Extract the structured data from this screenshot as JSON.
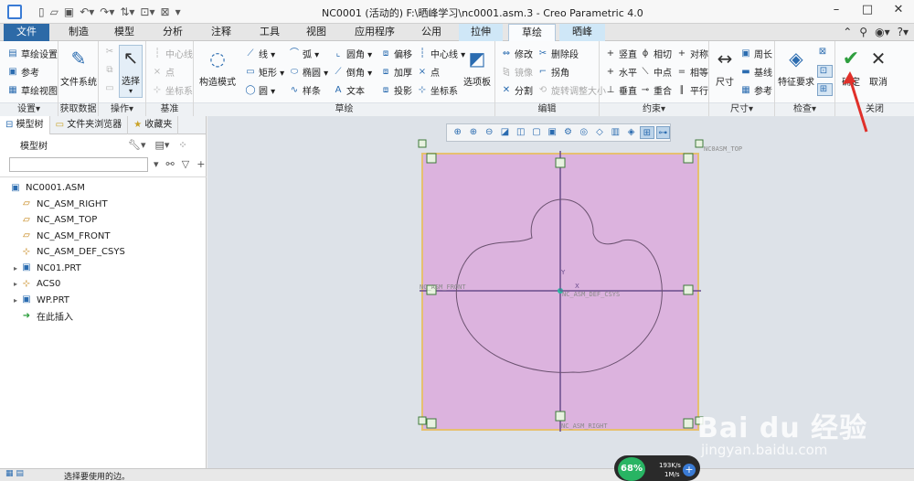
{
  "window": {
    "title": "NC0001 (活动的) F:\\晒峰学习\\nc0001.asm.3 - Creo Parametric 4.0",
    "controls": [
      "–",
      "□",
      "✕"
    ]
  },
  "tabs": [
    {
      "label": "文件",
      "id": "file"
    },
    {
      "label": "制造",
      "id": "mfg"
    },
    {
      "label": "模型",
      "id": "model"
    },
    {
      "label": "分析",
      "id": "analysis"
    },
    {
      "label": "注释",
      "id": "annotate"
    },
    {
      "label": "工具",
      "id": "tools"
    },
    {
      "label": "视图",
      "id": "view"
    },
    {
      "label": "应用程序",
      "id": "apps"
    },
    {
      "label": "公用",
      "id": "common"
    },
    {
      "label": "拉伸",
      "id": "extrude"
    },
    {
      "label": "草绘",
      "id": "sketch"
    },
    {
      "label": "晒峰",
      "id": "shaifeng"
    }
  ],
  "ribbon": {
    "setup": {
      "label": "设置▾",
      "items": [
        "草绘设置",
        "参考",
        "草绘视图"
      ]
    },
    "datum": {
      "label": "获取数据",
      "file_system": "文件系统"
    },
    "operations": {
      "label": "操作▾",
      "select": "选择"
    },
    "datum_group": {
      "label": "基准",
      "items": [
        "中心线",
        "点",
        "坐标系"
      ]
    },
    "sketching": {
      "label": "草绘",
      "construction": "构造模式",
      "col1": [
        "线 ▾",
        "矩形 ▾",
        "圆 ▾"
      ],
      "col2": [
        "弧 ▾",
        "椭圆 ▾",
        "样条"
      ],
      "col3": [
        "圆角 ▾",
        "倒角 ▾",
        "文本"
      ],
      "col4": [
        "偏移",
        "加厚",
        "投影"
      ],
      "col5": [
        "中心线 ▾",
        "点",
        "坐标系"
      ],
      "palette": "选项板"
    },
    "editing": {
      "label": "编辑",
      "col1": [
        "修改",
        "镜像",
        "分割"
      ],
      "col2": [
        "删除段",
        "拐角",
        "旋转调整大小"
      ]
    },
    "constrain": {
      "label": "约束▾",
      "col1": [
        "竖直",
        "水平",
        "垂直"
      ],
      "col2": [
        "相切",
        "中点",
        "重合"
      ],
      "col3": [
        "对称",
        "相等",
        "平行"
      ]
    },
    "dimension": {
      "label": "尺寸▾",
      "size": "尺寸",
      "items": [
        "周长",
        "基线",
        "参考"
      ]
    },
    "inspect": {
      "label": "检查▾",
      "feature_req": "特征要求"
    },
    "close": {
      "label": "关闭",
      "ok": "确定",
      "cancel": "取消"
    }
  },
  "left_panel": {
    "tabs": [
      "模型树",
      "文件夹浏览器",
      "收藏夹"
    ],
    "tree_title": "模型树",
    "search_placeholder": "",
    "items": [
      {
        "label": "NC0001.ASM",
        "icon": "assembly-icon",
        "arrow": ""
      },
      {
        "label": "NC_ASM_RIGHT",
        "icon": "datum-plane-icon",
        "arrow": ""
      },
      {
        "label": "NC_ASM_TOP",
        "icon": "datum-plane-icon",
        "arrow": ""
      },
      {
        "label": "NC_ASM_FRONT",
        "icon": "datum-plane-icon",
        "arrow": ""
      },
      {
        "label": "NC_ASM_DEF_CSYS",
        "icon": "csys-icon",
        "arrow": ""
      },
      {
        "label": "NC01.PRT",
        "icon": "part-icon",
        "arrow": "▸"
      },
      {
        "label": "ACS0",
        "icon": "csys-icon",
        "arrow": "▸"
      },
      {
        "label": "WP.PRT",
        "icon": "part-icon",
        "arrow": "▸"
      },
      {
        "label": "在此插入",
        "icon": "insert-here-icon",
        "arrow": ""
      }
    ]
  },
  "canvas": {
    "labels": {
      "top": "NC0ASM_TOP",
      "front": "NC_ASM_FRONT",
      "right": "NC_ASM_RIGHT",
      "csys": "NC_ASM_DEF_CSYS",
      "axis_y": "Y",
      "axis_x": "X"
    },
    "plane_color": "#dcb3de",
    "plane_border": "#e6c070"
  },
  "status": {
    "message": "选择要使用的边。"
  },
  "net": {
    "percent": "68%",
    "up": "193K/s",
    "down": "1M/s"
  },
  "watermark": {
    "logo": "Bai du 经验",
    "url": "jingyan.baidu.com"
  }
}
